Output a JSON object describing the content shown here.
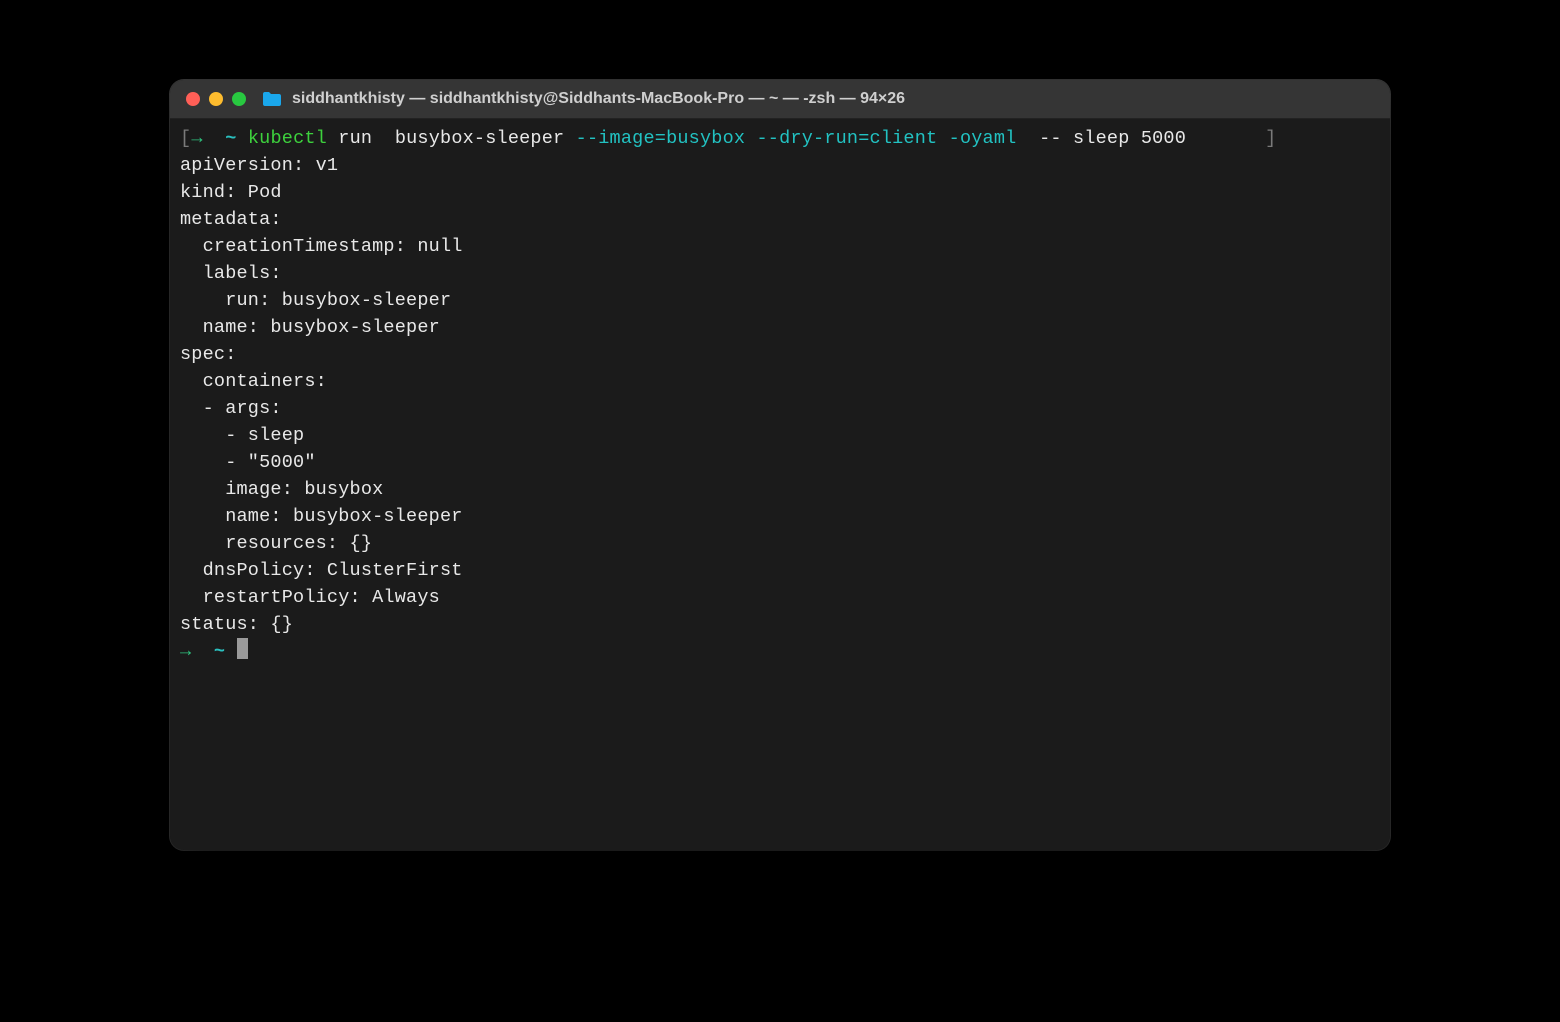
{
  "window": {
    "title": "siddhantkhisty — siddhantkhisty@Siddhants-MacBook-Pro — ~ — -zsh — 94×26"
  },
  "prompt": {
    "bracket_open": "[",
    "bracket_close": "]",
    "arrow": "→",
    "tilde": "~",
    "cmd_kubectl": "kubectl",
    "cmd_run": "run",
    "cmd_name": "busybox-sleeper",
    "flag_image": "--image=busybox",
    "flag_dryrun": "--dry-run=client",
    "flag_oyaml": "-oyaml",
    "sep": "--",
    "cmd_sleep": "sleep",
    "cmd_5000": "5000"
  },
  "output": {
    "l1": "apiVersion: v1",
    "l2": "kind: Pod",
    "l3": "metadata:",
    "l4": "  creationTimestamp: null",
    "l5": "  labels:",
    "l6": "    run: busybox-sleeper",
    "l7": "  name: busybox-sleeper",
    "l8": "spec:",
    "l9": "  containers:",
    "l10": "  - args:",
    "l11": "    - sleep",
    "l12": "    - \"5000\"",
    "l13": "    image: busybox",
    "l14": "    name: busybox-sleeper",
    "l15": "    resources: {}",
    "l16": "  dnsPolicy: ClusterFirst",
    "l17": "  restartPolicy: Always",
    "l18": "status: {}"
  }
}
